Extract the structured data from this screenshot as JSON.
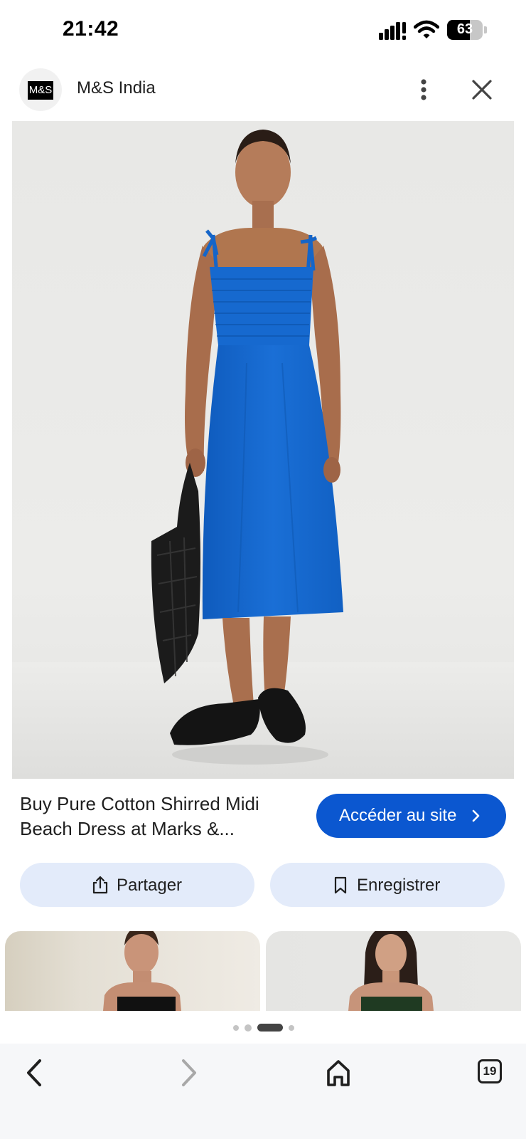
{
  "status_bar": {
    "time": "21:42",
    "battery_level": "63",
    "battery_fraction": 0.63,
    "icons": [
      "signal-icon",
      "wifi-icon",
      "battery-icon"
    ]
  },
  "header": {
    "logo_text": "M&S",
    "site_name": "M&S India",
    "icons": [
      "more-vertical-icon",
      "close-icon"
    ]
  },
  "image": {
    "description_icon": "product-photo",
    "dress_color": "#1565c8",
    "background_color": "#e9e9e7"
  },
  "result": {
    "caption": "Buy Pure Cotton Shirred Midi Beach Dress at Marks &...",
    "visit_label": "Accéder au site",
    "accent_color": "#0b57d0"
  },
  "actions": {
    "share_label": "Partager",
    "save_label": "Enregistrer",
    "pill_color": "#e3ebfa"
  },
  "related": {
    "items": [
      "related-image-black-dress",
      "related-image-green-dress"
    ]
  },
  "pager": {
    "count": 4,
    "active_index": 2
  },
  "bottom_nav": {
    "tab_count": "19",
    "icons": [
      "back-icon",
      "forward-icon",
      "home-icon",
      "tabs-icon"
    ]
  }
}
